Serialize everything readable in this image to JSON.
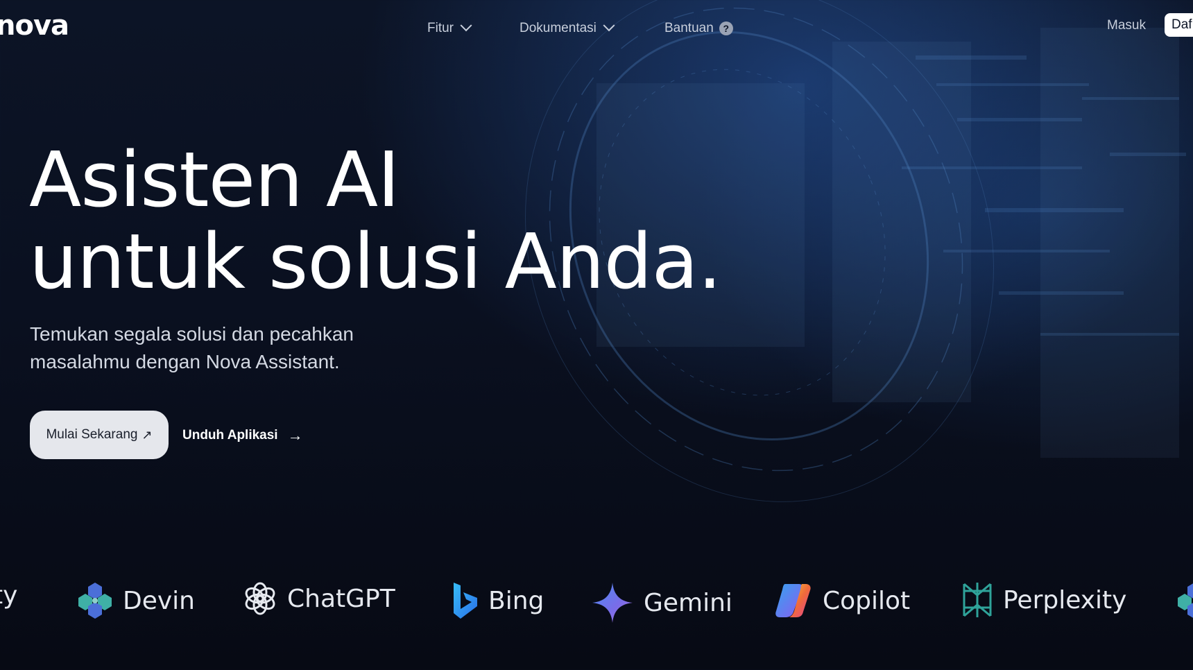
{
  "header": {
    "logo_text": "nova",
    "nav": [
      {
        "label": "Fitur"
      },
      {
        "label": "Dokumentasi"
      },
      {
        "label": "Bantuan"
      }
    ],
    "login_label": "Masuk",
    "signup_label": "Daf"
  },
  "hero": {
    "title_line1": "Asisten AI",
    "title_line2": "untuk solusi Anda.",
    "subtitle": "Temukan segala solusi dan pecahkan masalahmu dengan Nova Assistant.",
    "primary_cta": "Mulai Sekarang",
    "secondary_cta": "Unduh Aplikasi"
  },
  "brands": {
    "partial_left": "ity",
    "items": [
      "Devin",
      "ChatGPT",
      "Bing",
      "Gemini",
      "Copilot",
      "Perplexity"
    ]
  },
  "colors": {
    "background": "#0a1020",
    "accent_glow": "#285aaa",
    "button_bg": "#e5e7ec"
  }
}
